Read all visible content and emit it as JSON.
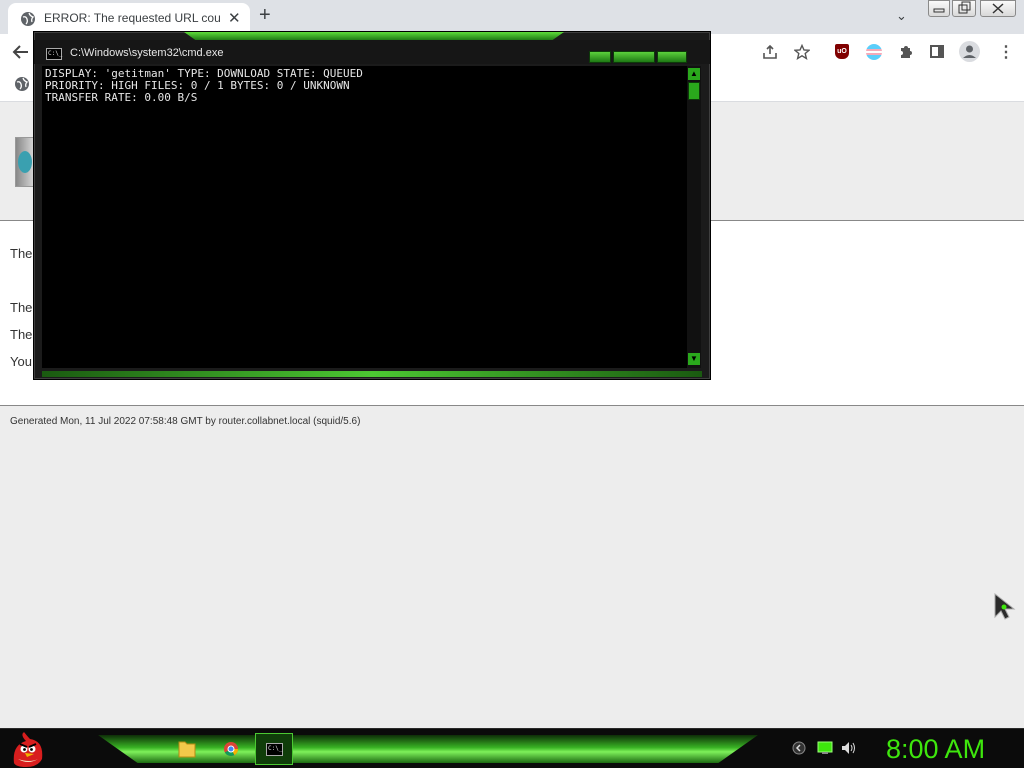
{
  "browser": {
    "tab_title": "ERROR: The requested URL could",
    "new_tab_label": "+",
    "tab_close_label": "✕",
    "tab_search_label": "⌄",
    "ublock_label": "uO"
  },
  "page": {
    "fragments": [
      "The",
      "The",
      "The",
      "You"
    ],
    "footer": "Generated Mon, 11 Jul 2022 07:58:48 GMT by router.collabnet.local (squid/5.6)"
  },
  "cmd": {
    "title": "C:\\Windows\\system32\\cmd.exe",
    "icon_text": "C:\\_",
    "lines": [
      "DISPLAY: 'getitman' TYPE: DOWNLOAD STATE: QUEUED",
      "PRIORITY: HIGH FILES: 0 / 1 BYTES: 0 / UNKNOWN",
      "TRANSFER RATE: 0.00 B/S"
    ],
    "scroll_up": "▲",
    "scroll_down": "▼"
  },
  "taskbar": {
    "clock": "8:00 AM",
    "cmd_icon_text": "C:\\_"
  },
  "colors": {
    "accent_green": "#3ee60d",
    "console_bg": "#000000",
    "console_text": "#e6e6e6"
  }
}
